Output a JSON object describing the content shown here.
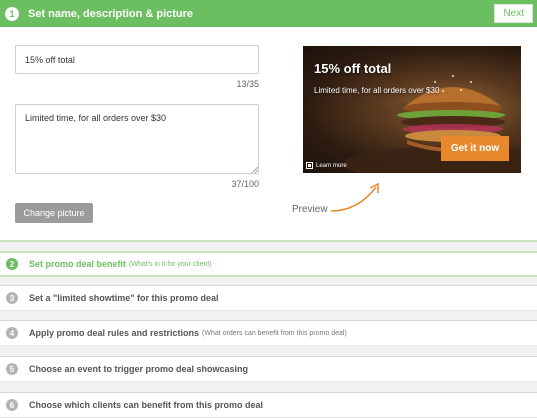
{
  "step1": {
    "number": "1",
    "title": "Set name, description & picture",
    "next_label": "Next"
  },
  "form": {
    "name_value": "15% off total",
    "name_counter": "13/35",
    "description_value": "Limited time, for all orders over $30",
    "description_counter": "37/100",
    "change_picture_label": "Change picture"
  },
  "preview": {
    "title": "15% off total",
    "description": "Limited time, for all orders over $30",
    "cta_label": "Get it now",
    "learn_more": "Learn more",
    "caption": "Preview"
  },
  "steps": [
    {
      "number": "2",
      "title": "Set promo deal benefit",
      "subtitle": "(What's in it for your client)",
      "active": true
    },
    {
      "number": "3",
      "title": "Set a \"limited showtime\" for this promo deal",
      "subtitle": ""
    },
    {
      "number": "4",
      "title": "Apply promo deal rules and restrictions",
      "subtitle": "(What orders can benefit from this promo deal)"
    },
    {
      "number": "5",
      "title": "Choose an event to trigger promo deal showcasing",
      "subtitle": ""
    },
    {
      "number": "6",
      "title": "Choose which clients can benefit from this promo deal",
      "subtitle": ""
    }
  ],
  "colors": {
    "accent_green": "#6cbf60",
    "cta_orange": "#e8892e",
    "button_gray": "#9b9b9b"
  }
}
